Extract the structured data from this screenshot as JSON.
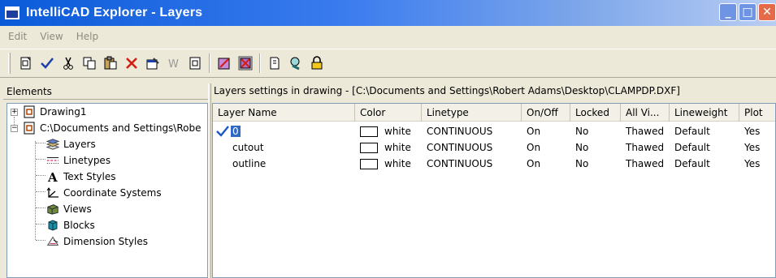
{
  "window": {
    "title": "IntelliCAD Explorer - Layers"
  },
  "menu": {
    "items": [
      "Edit",
      "View",
      "Help"
    ]
  },
  "left": {
    "header": "Elements",
    "tree": [
      {
        "label": "Drawing1",
        "icon": "drawing-icon",
        "expander": "+"
      },
      {
        "label": "C:\\Documents and Settings\\Robe",
        "icon": "drawing-icon",
        "expander": "−"
      },
      {
        "label": "Layers",
        "icon": "layers-icon"
      },
      {
        "label": "Linetypes",
        "icon": "linetypes-icon"
      },
      {
        "label": "Text Styles",
        "icon": "text-styles-icon"
      },
      {
        "label": "Coordinate Systems",
        "icon": "ucs-icon"
      },
      {
        "label": "Views",
        "icon": "views-icon"
      },
      {
        "label": "Blocks",
        "icon": "blocks-icon"
      },
      {
        "label": "Dimension Styles",
        "icon": "dimension-styles-icon"
      }
    ]
  },
  "right": {
    "header": "Layers settings in drawing - [C:\\Documents and Settings\\Robert Adams\\Desktop\\CLAMPDP.DXF]",
    "columns": [
      "Layer Name",
      "Color",
      "Linetype",
      "On/Off",
      "Locked",
      "All Vi...",
      "Lineweight",
      "Plot"
    ],
    "rows": [
      {
        "current": true,
        "name": "0",
        "color": "white",
        "linetype": "CONTINUOUS",
        "onoff": "On",
        "locked": "No",
        "allvi": "Thawed",
        "lineweight": "Default",
        "plot": "Yes"
      },
      {
        "current": false,
        "name": "cutout",
        "color": "white",
        "linetype": "CONTINUOUS",
        "onoff": "On",
        "locked": "No",
        "allvi": "Thawed",
        "lineweight": "Default",
        "plot": "Yes"
      },
      {
        "current": false,
        "name": "outline",
        "color": "white",
        "linetype": "CONTINUOUS",
        "onoff": "On",
        "locked": "No",
        "allvi": "Thawed",
        "lineweight": "Default",
        "plot": "Yes"
      }
    ]
  },
  "colors": {
    "titlebar": "#0a5ad8",
    "selection": "#316ac5",
    "accent_check": "#1a57c8"
  }
}
